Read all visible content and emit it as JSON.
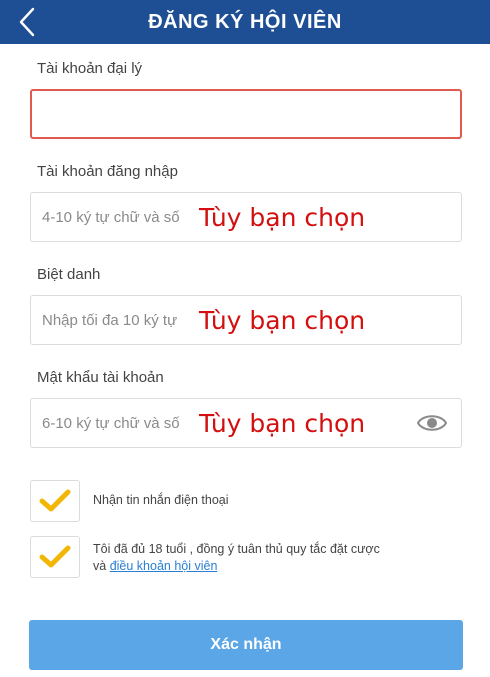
{
  "header": {
    "title": "ĐĂNG KÝ HỘI VIÊN",
    "back_icon": "chevron-left-icon"
  },
  "form": {
    "agent_account": {
      "label": "Tài khoản đại lý",
      "value": "",
      "placeholder": ""
    },
    "login_account": {
      "label": "Tài khoản đăng nhập",
      "placeholder": "4-10 ký tự chữ và số",
      "hint": "Tùy bạn chọn"
    },
    "nickname": {
      "label": "Biệt danh",
      "placeholder": "Nhập tối đa 10 ký tự",
      "hint": "Tùy bạn chọn"
    },
    "password": {
      "label": "Mật khẩu tài khoản",
      "placeholder": "6-10 ký tự chữ và số",
      "hint": "Tùy bạn chọn",
      "toggle_icon": "eye-icon"
    }
  },
  "checks": {
    "sms": {
      "label": "Nhận tin nhắn điện thoại",
      "checked": true
    },
    "terms": {
      "line1": "Tôi đã đủ 18 tuổi , đồng ý tuân thủ quy tắc đặt cược",
      "prefix": "và ",
      "link": "điều khoản hội viên",
      "checked": true
    }
  },
  "submit_label": "Xác nhận",
  "colors": {
    "header_bg": "#1e4f94",
    "hint": "#d40f0f",
    "error_border": "#e05a4f",
    "check": "#f2b705",
    "button": "#5aa6e6",
    "link": "#2a7fd4"
  }
}
